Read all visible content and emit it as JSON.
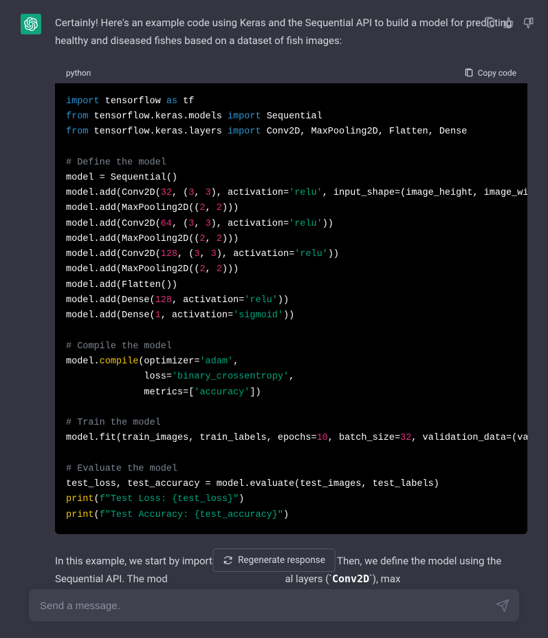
{
  "assistant": {
    "intro_text": "Certainly! Here's an example code using Keras and the Sequential API to build a model for predicting healthy and diseased fishes based on a dataset of fish images:",
    "outro_prefix": "In this example, we start by importin",
    "outro_mid": "s. Then, we define the model using the Sequential API. The mod",
    "outro_suffix": "al layers (`",
    "outro_code": "Conv2D",
    "outro_tail": "`), max"
  },
  "code": {
    "lang": "python",
    "copy_label": "Copy code",
    "tokens": [
      [
        [
          "kw",
          "import"
        ],
        [
          "op",
          " "
        ],
        [
          "id",
          "tensorflow"
        ],
        [
          "op",
          " "
        ],
        [
          "kw",
          "as"
        ],
        [
          "op",
          " "
        ],
        [
          "id",
          "tf"
        ]
      ],
      [
        [
          "kw",
          "from"
        ],
        [
          "op",
          " "
        ],
        [
          "id",
          "tensorflow.keras.models"
        ],
        [
          "op",
          " "
        ],
        [
          "kw",
          "import"
        ],
        [
          "op",
          " "
        ],
        [
          "id",
          "Sequential"
        ]
      ],
      [
        [
          "kw",
          "from"
        ],
        [
          "op",
          " "
        ],
        [
          "id",
          "tensorflow.keras.layers"
        ],
        [
          "op",
          " "
        ],
        [
          "kw",
          "import"
        ],
        [
          "op",
          " "
        ],
        [
          "id",
          "Conv2D, MaxPooling2D, Flatten, Dense"
        ]
      ],
      [],
      [
        [
          "cmt",
          "# Define the model"
        ]
      ],
      [
        [
          "id",
          "model = Sequential()"
        ]
      ],
      [
        [
          "id",
          "model.add(Conv2D("
        ],
        [
          "num",
          "32"
        ],
        [
          "id",
          ", ("
        ],
        [
          "num",
          "3"
        ],
        [
          "id",
          ", "
        ],
        [
          "num",
          "3"
        ],
        [
          "id",
          "), activation="
        ],
        [
          "str",
          "'relu'"
        ],
        [
          "id",
          ", input_shape=(image_height, image_width, num_channels)))"
        ]
      ],
      [
        [
          "id",
          "model.add(MaxPooling2D(("
        ],
        [
          "num",
          "2"
        ],
        [
          "id",
          ", "
        ],
        [
          "num",
          "2"
        ],
        [
          "id",
          ")))"
        ]
      ],
      [
        [
          "id",
          "model.add(Conv2D("
        ],
        [
          "num",
          "64"
        ],
        [
          "id",
          ", ("
        ],
        [
          "num",
          "3"
        ],
        [
          "id",
          ", "
        ],
        [
          "num",
          "3"
        ],
        [
          "id",
          "), activation="
        ],
        [
          "str",
          "'relu'"
        ],
        [
          "id",
          "))"
        ]
      ],
      [
        [
          "id",
          "model.add(MaxPooling2D(("
        ],
        [
          "num",
          "2"
        ],
        [
          "id",
          ", "
        ],
        [
          "num",
          "2"
        ],
        [
          "id",
          ")))"
        ]
      ],
      [
        [
          "id",
          "model.add(Conv2D("
        ],
        [
          "num",
          "128"
        ],
        [
          "id",
          ", ("
        ],
        [
          "num",
          "3"
        ],
        [
          "id",
          ", "
        ],
        [
          "num",
          "3"
        ],
        [
          "id",
          "), activation="
        ],
        [
          "str",
          "'relu'"
        ],
        [
          "id",
          "))"
        ]
      ],
      [
        [
          "id",
          "model.add(MaxPooling2D(("
        ],
        [
          "num",
          "2"
        ],
        [
          "id",
          ", "
        ],
        [
          "num",
          "2"
        ],
        [
          "id",
          ")))"
        ]
      ],
      [
        [
          "id",
          "model.add(Flatten())"
        ]
      ],
      [
        [
          "id",
          "model.add(Dense("
        ],
        [
          "num",
          "128"
        ],
        [
          "id",
          ", activation="
        ],
        [
          "str",
          "'relu'"
        ],
        [
          "id",
          "))"
        ]
      ],
      [
        [
          "id",
          "model.add(Dense("
        ],
        [
          "num",
          "1"
        ],
        [
          "id",
          ", activation="
        ],
        [
          "str",
          "'sigmoid'"
        ],
        [
          "id",
          "))"
        ]
      ],
      [],
      [
        [
          "cmt",
          "# Compile the model"
        ]
      ],
      [
        [
          "id",
          "model."
        ],
        [
          "fn",
          "compile"
        ],
        [
          "id",
          "(optimizer="
        ],
        [
          "str",
          "'adam'"
        ],
        [
          "id",
          ","
        ]
      ],
      [
        [
          "id",
          "              loss="
        ],
        [
          "str",
          "'binary_crossentropy'"
        ],
        [
          "id",
          ","
        ]
      ],
      [
        [
          "id",
          "              metrics=["
        ],
        [
          "str",
          "'accuracy'"
        ],
        [
          "id",
          "])"
        ]
      ],
      [],
      [
        [
          "cmt",
          "# Train the model"
        ]
      ],
      [
        [
          "id",
          "model.fit(train_images, train_labels, epochs="
        ],
        [
          "num",
          "10"
        ],
        [
          "id",
          ", batch_size="
        ],
        [
          "num",
          "32"
        ],
        [
          "id",
          ", validation_data=(val_images, val_labels))"
        ]
      ],
      [],
      [
        [
          "cmt",
          "# Evaluate the model"
        ]
      ],
      [
        [
          "id",
          "test_loss, test_accuracy = model.evaluate(test_images, test_labels)"
        ]
      ],
      [
        [
          "fn",
          "print"
        ],
        [
          "id",
          "("
        ],
        [
          "str",
          "f\"Test Loss: {test_loss}\""
        ],
        [
          "id",
          ")"
        ]
      ],
      [
        [
          "fn",
          "print"
        ],
        [
          "id",
          "("
        ],
        [
          "str",
          "f\"Test Accuracy: {test_accuracy}\""
        ],
        [
          "id",
          ")"
        ]
      ]
    ]
  },
  "regen": {
    "label": "Regenerate response"
  },
  "input": {
    "placeholder": "Send a message."
  }
}
